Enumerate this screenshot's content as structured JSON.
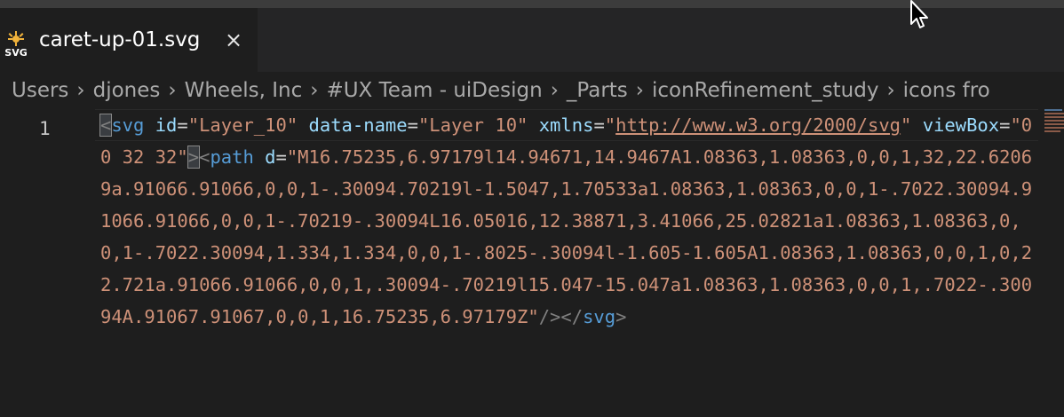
{
  "tab": {
    "title": "caret-up-01.svg",
    "close_glyph": "×",
    "file_icon": "svg-file-icon",
    "file_icon_label": "SVG"
  },
  "breadcrumb": [
    "Users",
    "djones",
    "Wheels, Inc",
    "#UX Team - uiDesign",
    "_Parts",
    "iconRefinement_study",
    "icons fro"
  ],
  "breadcrumb_separator": "›",
  "editor": {
    "line_number": "1",
    "tokens": {
      "lt1": "<",
      "svg_tag": "svg",
      "attr_id": "id",
      "eq": "=",
      "val_id": "\"Layer_10\"",
      "attr_dataname": "data-name",
      "val_dataname": "\"Layer 10\"",
      "attr_xmlns": "xmlns",
      "q_open": "\"",
      "url": "http://www.w3.org/2000/svg",
      "q_close": "\"",
      "attr_viewbox": "viewBox",
      "val_viewbox": "\"0 0 32 32\"",
      "gt1": ">",
      "lt2": "<",
      "path_tag": "path",
      "attr_d": "d",
      "val_d": "\"M16.75235,6.97179l14.94671,14.9467A1.08363,1.08363,0,0,1,32,22.62069a.91066.91066,0,0,1-.30094.70219l-1.5047,1.70533a1.08363,1.08363,0,0,1-.7022.30094.91066.91066,0,0,1-.70219-.30094L16.05016,12.38871,3.41066,25.02821a1.08363,1.08363,0,0,1-.7022.30094,1.334,1.334,0,0,1-.8025-.30094l-1.605-1.605A1.08363,1.08363,0,0,1,0,22.721a.91066.91066,0,0,1,.30094-.70219l15.047-15.047a1.08363,1.08363,0,0,1,.7022-.30094A.91067.91067,0,0,1,16.75235,6.97179Z\"",
      "selfclose": "/>",
      "close_open": "</",
      "close_tag": "svg",
      "gt_end": ">"
    }
  },
  "colors": {
    "background": "#1e1e1e",
    "tab_bar": "#252526",
    "tag": "#569cd6",
    "attribute": "#9cdcfe",
    "string": "#ce9178",
    "punctuation": "#808080",
    "icon_accent": "#f1b33b"
  }
}
